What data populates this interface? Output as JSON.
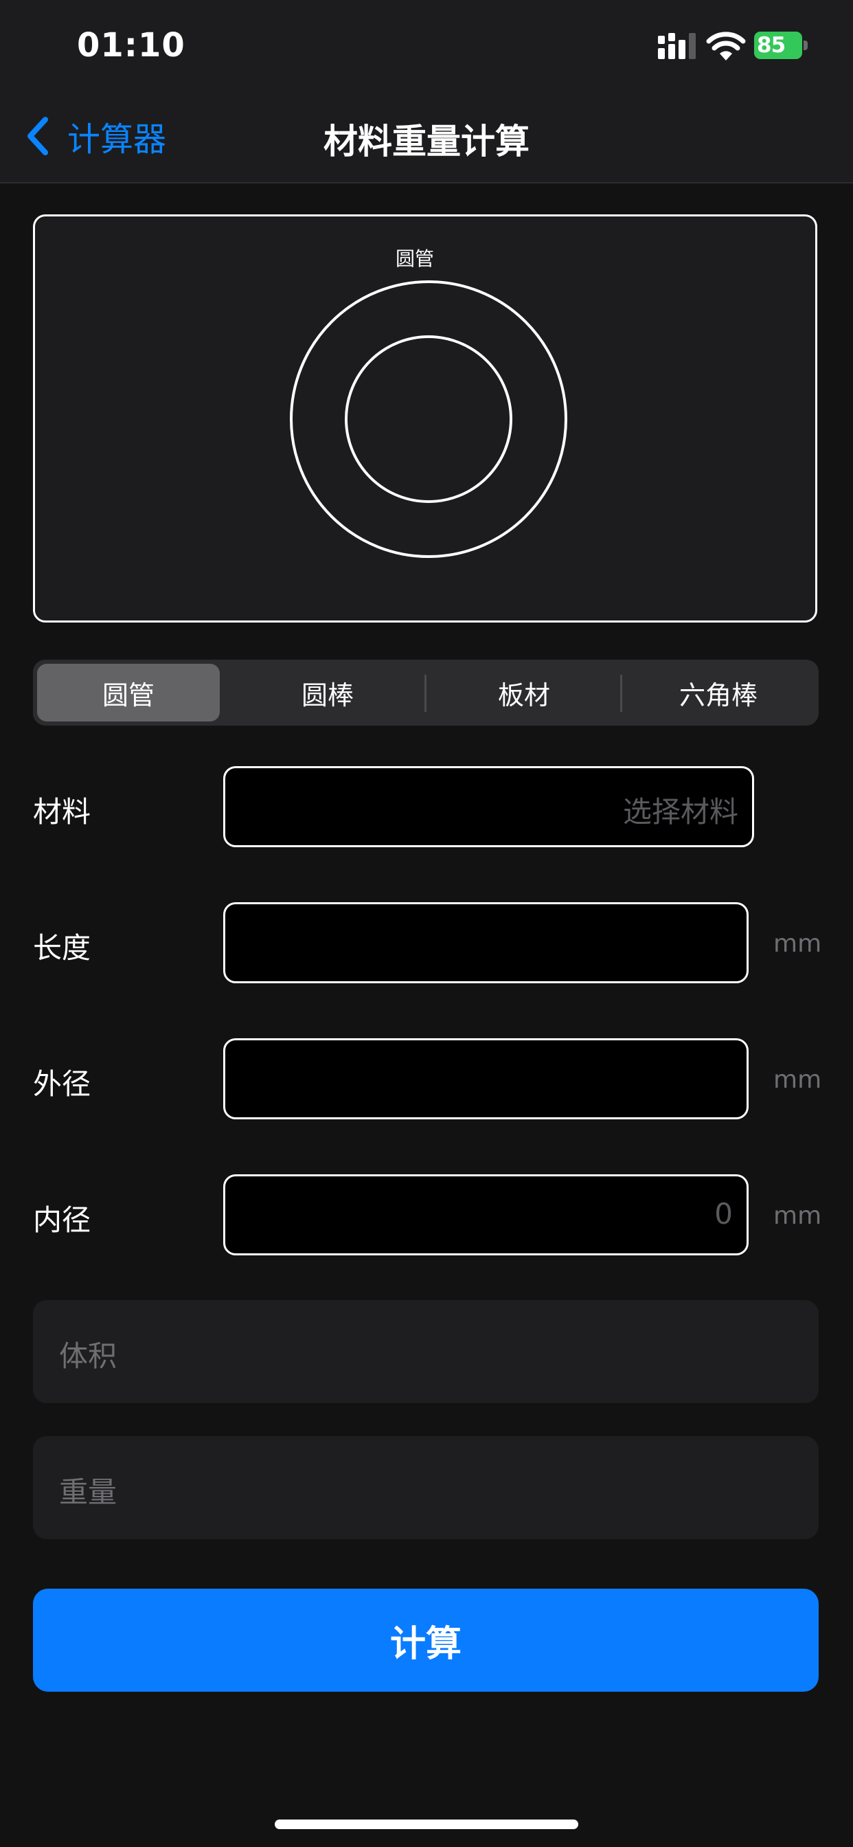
{
  "status_bar": {
    "time": "01:10",
    "battery_level": "85",
    "icons": [
      "signal-icon",
      "wifi-icon",
      "battery-icon"
    ]
  },
  "nav": {
    "back_label": "计算器",
    "title": "材料重量计算"
  },
  "preview": {
    "caption": "圆管"
  },
  "segments": {
    "selected": "圆管",
    "items": [
      "圆管",
      "圆棒",
      "板材",
      "六角棒"
    ]
  },
  "form": {
    "material": {
      "label": "材料",
      "placeholder": "选择材料"
    },
    "length": {
      "label": "长度",
      "value": "",
      "unit": "mm"
    },
    "outer_diameter": {
      "label": "外径",
      "value": "",
      "unit": "mm"
    },
    "inner_diameter": {
      "label": "内径",
      "placeholder": "0",
      "unit": "mm"
    }
  },
  "results": {
    "volume_label": "体积",
    "weight_label": "重量"
  },
  "actions": {
    "calculate_label": "计算"
  },
  "colors": {
    "accent": "#0a84ff",
    "button": "#0a7cff",
    "battery": "#34c759",
    "background": "#121212",
    "bar": "#1c1c1e"
  }
}
